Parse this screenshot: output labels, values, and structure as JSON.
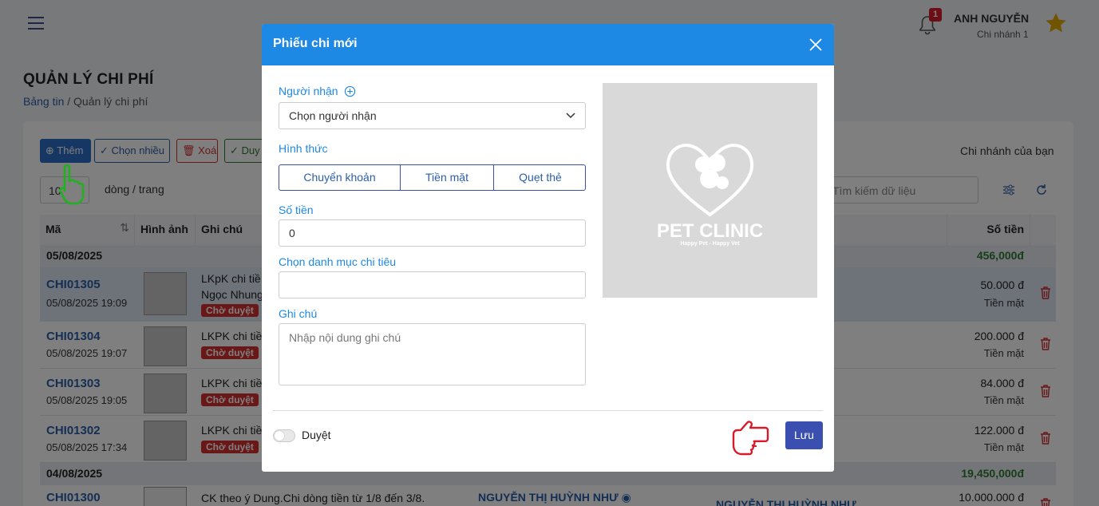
{
  "topbar": {
    "notification_count": "1",
    "user_name": "ANH NGUYỄN",
    "user_branch": "Chi nhánh 1"
  },
  "page": {
    "title": "QUẢN LÝ CHI PHÍ",
    "breadcrumb_home": "Bảng tin",
    "breadcrumb_sep": "/",
    "breadcrumb_current": "Quản lý chi phí"
  },
  "toolbar": {
    "add_label": "Thêm",
    "multi_label": "Chọn nhiều",
    "delete_label": "Xoá",
    "approve_label": "Duy",
    "branch_label": "Chi nhánh của bạn",
    "per_page_value": "10",
    "per_page_label": "dòng / trang",
    "search_placeholder": "Tìm kiếm dữ liệu"
  },
  "table": {
    "headers": {
      "code": "Mã",
      "image": "Hình ảnh",
      "note": "Ghi chú",
      "amount": "Số tiền"
    },
    "groups": [
      {
        "date": "05/08/2025",
        "total": "456,000đ"
      },
      {
        "date": "04/08/2025",
        "total": "19,450,000đ"
      }
    ],
    "rows": [
      {
        "code": "CHI01305",
        "date": "05/08/2025 19:09",
        "note_line1": "LKpK chi tiề",
        "note_line2": "Ngọc Nhung",
        "badge": "Chờ duyệt",
        "amount": "50.000 đ",
        "method": "Tiền mặt"
      },
      {
        "code": "CHI01304",
        "date": "05/08/2025 19:07",
        "note_line1": "LKPK chi tiề",
        "badge": "Chờ duyệt",
        "amount": "200.000 đ",
        "method": "Tiền mặt"
      },
      {
        "code": "CHI01303",
        "date": "05/08/2025 19:05",
        "note_line1": "LKPK chi tiề",
        "badge": "Chờ duyệt",
        "amount": "84.000 đ",
        "method": "Tiền mặt"
      },
      {
        "code": "CHI01302",
        "date": "05/08/2025 17:34",
        "note_line1": "LKPK chi tiề",
        "badge": "Chờ duyệt",
        "amount": "122.000 đ",
        "method": "Tiền mặt"
      },
      {
        "code": "CHI01300",
        "note_line1": "CK theo ý Dung.Chi dòng tiền từ 1/8 đến 3/8.",
        "recipient": "NGUYỄN THỊ HUỲNH NHƯ",
        "creator": "NGUYỄN THỊ HUỲNH NHƯ",
        "amount": "10.000.000 đ"
      }
    ]
  },
  "modal": {
    "title": "Phiếu chi mới",
    "recipient_label": "Người nhận",
    "recipient_placeholder": "Chọn người nhận",
    "method_label": "Hình thức",
    "methods": [
      "Chuyển khoản",
      "Tiền mặt",
      "Quẹt thẻ"
    ],
    "amount_label": "Số tiền",
    "amount_value": "0",
    "category_label": "Chọn danh mục chi tiêu",
    "note_label": "Ghi chú",
    "note_placeholder": "Nhập nội dung ghi chú",
    "logo_text": "PET CLINIC",
    "logo_tagline": "Happy Pet - Happy Vet",
    "approve_toggle_label": "Duyệt",
    "save_label": "Lưu"
  }
}
